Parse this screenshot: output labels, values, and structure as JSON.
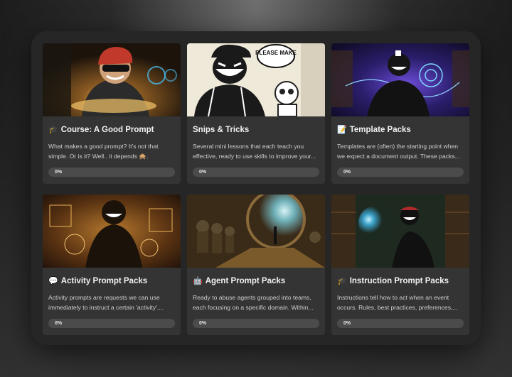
{
  "cards": [
    {
      "emoji": "🎓",
      "title": "Course: A Good Prompt",
      "description": "What makes a good prompt? It's not that simple. Or is it? Well.. it depends 🙊.",
      "progress_label": "0%",
      "progress": 0,
      "image": "masked-hacker-at-glowing-desk"
    },
    {
      "emoji": "",
      "title": "Snips & Tricks",
      "description": "Several mini lessons that each teach you effective, ready to use skills to improve your...",
      "progress_label": "0%",
      "progress": 0,
      "image": "comic-hacker-with-robot",
      "speech_bubble": "PLEASE MAKE"
    },
    {
      "emoji": "📝",
      "title": "Template Packs",
      "description": "Templates are (often) the starting point when we expect a document output. These packs...",
      "progress_label": "0%",
      "progress": 0,
      "image": "hacker-with-holographic-circuits"
    },
    {
      "emoji": "💬",
      "title": "Activity Prompt Packs",
      "description": "Activity prompts are requests we can use immediately to instruct a certain 'activity'....",
      "progress_label": "0%",
      "progress": 0,
      "image": "hacker-with-golden-diagrams"
    },
    {
      "emoji": "🤖",
      "title": "Agent Prompt Packs",
      "description": "Ready to abuse agents grouped into teams, each focusing on a specific domain. Within...",
      "progress_label": "0%",
      "progress": 0,
      "image": "agents-facing-portal"
    },
    {
      "emoji": "🎓",
      "title": "Instruction Prompt Packs",
      "description": "Instructions tell how to act when an event occurs. Rules, best practices, preferences,...",
      "progress_label": "0%",
      "progress": 0,
      "image": "hacker-in-library-with-hologram"
    }
  ]
}
